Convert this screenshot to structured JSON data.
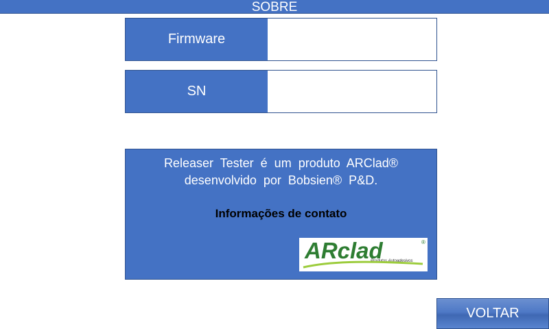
{
  "header": {
    "title": "SOBRE"
  },
  "fields": [
    {
      "label": "Firmware",
      "value": ""
    },
    {
      "label": "SN",
      "value": ""
    }
  ],
  "info": {
    "line1": "Releaser  Tester  é  um  produto  ARClad®",
    "line2": "desenvolvido  por  Bobsien®  P&D.",
    "contact": "Informações de contato",
    "logo": {
      "brand": "ARclad",
      "tagline": "Produtos Autoadesivos",
      "color": "#2e7d32"
    }
  },
  "footer": {
    "back_label": "VOLTAR"
  },
  "colors": {
    "primary": "#4472c4",
    "border": "#2f528f"
  }
}
